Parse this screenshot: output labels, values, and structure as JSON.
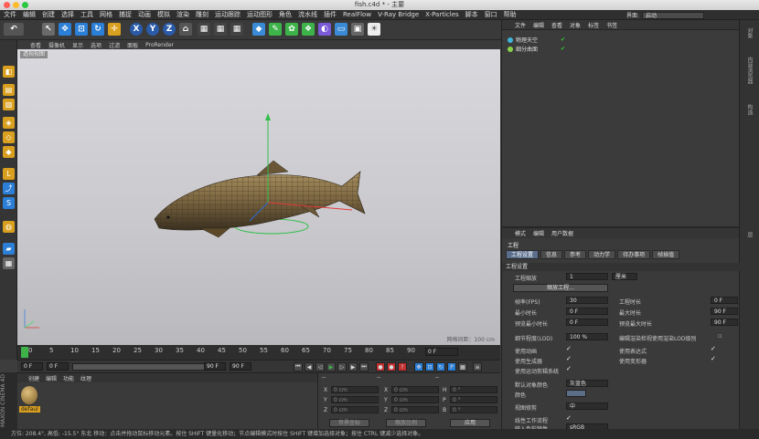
{
  "window": {
    "title": "fish.c4d * - 主要"
  },
  "menubar": {
    "items": [
      "文件",
      "编辑",
      "创建",
      "选择",
      "工具",
      "网格",
      "捕捉",
      "动画",
      "模拟",
      "渲染",
      "雕刻",
      "运动跟踪",
      "运动图形",
      "角色",
      "流水线",
      "插件",
      "RealFlow",
      "V-Ray Bridge",
      "X-Particles",
      "脚本",
      "窗口",
      "帮助"
    ]
  },
  "layout": {
    "label": "界面:",
    "value": "启动"
  },
  "viewport": {
    "menu": [
      "查看",
      "摄像机",
      "显示",
      "选项",
      "过滤",
      "面板",
      "ProRender"
    ],
    "label": "透视视图",
    "grid_spacing": "网格间距：100 cm"
  },
  "timeline": {
    "ticks": [
      "0",
      "5",
      "10",
      "15",
      "20",
      "25",
      "30",
      "35",
      "40",
      "45",
      "50",
      "55",
      "60",
      "65",
      "70",
      "75",
      "80",
      "85",
      "90"
    ],
    "frame_field": "0 F"
  },
  "transport": {
    "start": "0 F",
    "current": "0 F",
    "end": "90 F",
    "end2": "90 F"
  },
  "material_panel": {
    "menu": [
      "创建",
      "编辑",
      "功能",
      "纹理"
    ],
    "material_name": "defaul",
    "brand": "MAXON CINEMA 4D"
  },
  "coord_panel": {
    "header_dash1": "--",
    "header_dash2": "--",
    "header_dash3": "--",
    "rows": [
      {
        "l1": "X",
        "v1": "0 cm",
        "l2": "X",
        "v2": "0 cm",
        "l3": "H",
        "v3": "0 °"
      },
      {
        "l1": "Y",
        "v1": "0 cm",
        "l2": "Y",
        "v2": "0 cm",
        "l3": "P",
        "v3": "0 °"
      },
      {
        "l1": "Z",
        "v1": "0 cm",
        "l2": "Z",
        "v2": "0 cm",
        "l3": "B",
        "v3": "0 °"
      }
    ],
    "world_coords": "世界坐标",
    "scale": "缩放比例",
    "apply": "应用"
  },
  "object_panel": {
    "menu": [
      "文件",
      "编辑",
      "查看",
      "对象",
      "标签",
      "书签"
    ],
    "objects": [
      {
        "name": "物理天空",
        "color": "#3fb5d9"
      },
      {
        "name": "细分曲面",
        "color": "#8ad14a"
      }
    ]
  },
  "side_tabs": [
    "对象",
    "内容浏览器",
    "构造",
    "层"
  ],
  "attr_panel": {
    "menu": [
      "模式",
      "编辑",
      "用户数据"
    ],
    "title": "工程",
    "tabs": [
      "工程设置",
      "信息",
      "参考",
      "动力学",
      "待办事项",
      "帧插值"
    ],
    "section": "工程设置",
    "scale_label": "工程缩放",
    "scale_value": "1",
    "scale_unit": "厘米",
    "scale_button": "缩放工程...",
    "fps_label": "帧率(FPS)",
    "fps_value": "30",
    "duration_label": "工程时长",
    "duration_value": "0 F",
    "min_time_label": "最小时长",
    "min_time_value": "0 F",
    "max_time_label": "最大时长",
    "max_time_value": "90 F",
    "preview_min_label": "预览最小时长",
    "preview_min_value": "0 F",
    "preview_max_label": "预览最大时长",
    "preview_max_value": "90 F",
    "lod_label": "细节程度(LOD)",
    "lod_value": "100 %",
    "render_lod_label": "编辑渲染检视使用渲染LOD级别",
    "use_anim_label": "使用动画",
    "use_expr_label": "使用表达式",
    "use_gen_label": "使用生成器",
    "use_deform_label": "使用变形器",
    "use_motion_label": "使用运动剪辑系统",
    "default_color_label": "默认对象颜色",
    "default_color_value": "灰蓝色",
    "color_label": "颜色",
    "view_clip_label": "视图修剪",
    "view_clip_value": "中",
    "linear_label": "线性工作流程",
    "input_color_label": "输入色彩特性",
    "input_color_value": "sRGB"
  },
  "status": {
    "text": "方位: 208.4°, 高低: -15.5° 东北    移动：点击并拖动鼠标移动元素。按住 SHIFT 键量化移动；节点编辑模式时按住 SHIFT 键增加选择对象；按住 CTRL 键减少选择对象。"
  }
}
